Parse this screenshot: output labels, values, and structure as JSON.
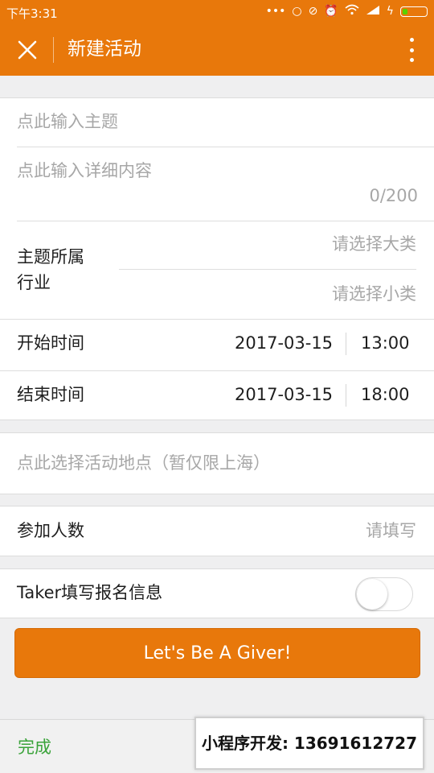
{
  "status_bar": {
    "time": "下午3:31",
    "icons": [
      "dots-icon",
      "alarm-circle-icon",
      "mute-icon",
      "alarm-clock-icon",
      "wifi-icon",
      "signal-icon",
      "charging-icon",
      "battery-icon"
    ]
  },
  "app_bar": {
    "title": "新建活动"
  },
  "topic": {
    "placeholder": "点此输入主题"
  },
  "detail": {
    "placeholder": "点此输入详细内容",
    "counter": "0/200"
  },
  "industry": {
    "label_line1": "主题所属",
    "label_line2": "行业",
    "major_placeholder": "请选择大类",
    "minor_placeholder": "请选择小类"
  },
  "start": {
    "label": "开始时间",
    "date": "2017-03-15",
    "time": "13:00"
  },
  "end": {
    "label": "结束时间",
    "date": "2017-03-15",
    "time": "18:00"
  },
  "location": {
    "placeholder": "点此选择活动地点（暂仅限上海）"
  },
  "participants": {
    "label": "参加人数",
    "placeholder": "请填写"
  },
  "taker_info": {
    "label": "Taker填写报名信息",
    "enabled": false
  },
  "submit_button": {
    "label": "Let's Be A Giver!"
  },
  "bottom_bar": {
    "done_label": "完成"
  },
  "promo": {
    "text": "小程序开发: 13691612727"
  },
  "colors": {
    "accent": "#e8780b",
    "done_green": "#3aa33a",
    "background": "#efeff0"
  }
}
